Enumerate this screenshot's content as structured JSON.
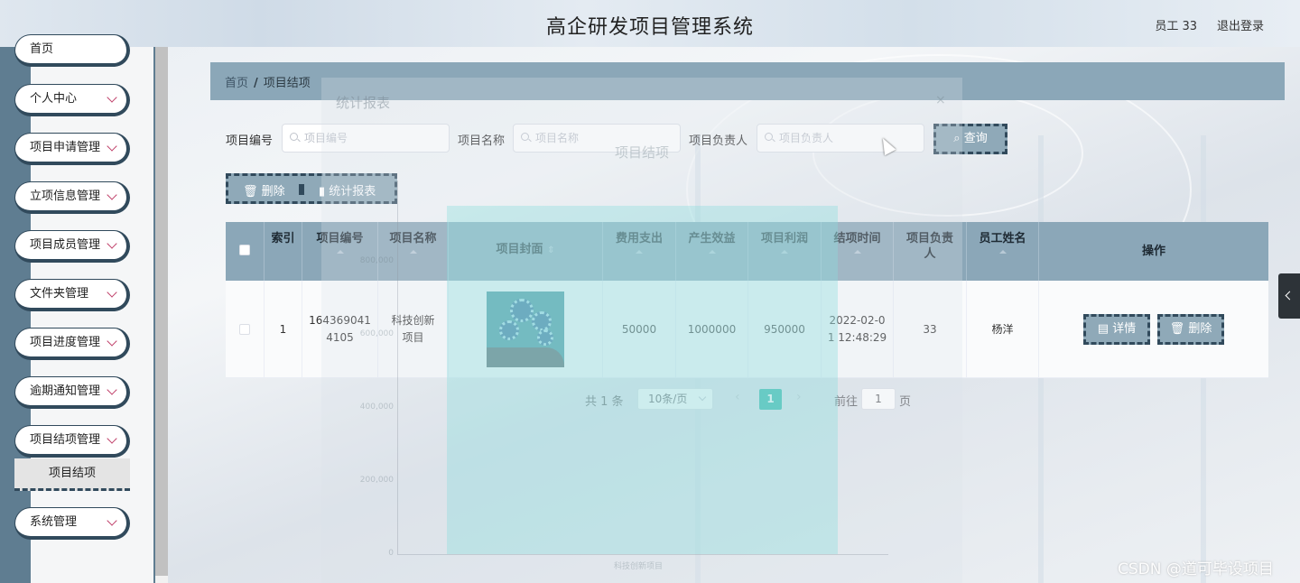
{
  "header": {
    "title": "高企研发项目管理系统",
    "user_label": "员工 33",
    "logout_label": "退出登录"
  },
  "sidebar": {
    "items": [
      {
        "label": "首页"
      },
      {
        "label": "个人中心"
      },
      {
        "label": "项目申请管理"
      },
      {
        "label": "立项信息管理"
      },
      {
        "label": "项目成员管理"
      },
      {
        "label": "文件夹管理"
      },
      {
        "label": "项目进度管理"
      },
      {
        "label": "逾期通知管理"
      },
      {
        "label": "项目结项管理"
      },
      {
        "label": "系统管理"
      }
    ],
    "active_sub": "项目结项"
  },
  "breadcrumb": {
    "home": "首页",
    "sep": "/",
    "current": "项目结项"
  },
  "search": {
    "fields": [
      {
        "label": "项目编号",
        "placeholder": "项目编号"
      },
      {
        "label": "项目名称",
        "placeholder": "项目名称"
      },
      {
        "label": "项目负责人",
        "placeholder": "项目负责人"
      }
    ],
    "query_label": "查询"
  },
  "actions": {
    "delete_label": "删除",
    "stats_label": "统计报表"
  },
  "table": {
    "columns": [
      "索引",
      "项目编号",
      "项目名称",
      "项目封面",
      "费用支出",
      "产生效益",
      "项目利润",
      "结项时间",
      "项目负责人",
      "员工姓名",
      "操作"
    ],
    "rows": [
      {
        "index": "1",
        "project_no": "1643690414105",
        "project_name": "科技创新项目",
        "expense": "50000",
        "benefit": "1000000",
        "profit": "950000",
        "end_time": "2022-02-01 12:48:29",
        "leader": "33",
        "employee": "杨洋",
        "detail_label": "详情",
        "delete_label": "删除"
      }
    ]
  },
  "pagination": {
    "total": "共 1 条",
    "page_size": "10条/页",
    "current_page": "1",
    "goto_label": "前往",
    "goto_value": "1",
    "unit": "页"
  },
  "ghost_dialog": {
    "title": "统计报表",
    "close": "×",
    "chart_title": "项目结项",
    "ticks": [
      "800,000",
      "600,000",
      "400,000",
      "200,000",
      "0"
    ],
    "x_label": "科技创新项目"
  },
  "watermark": "CSDN @道可毕设项目"
}
